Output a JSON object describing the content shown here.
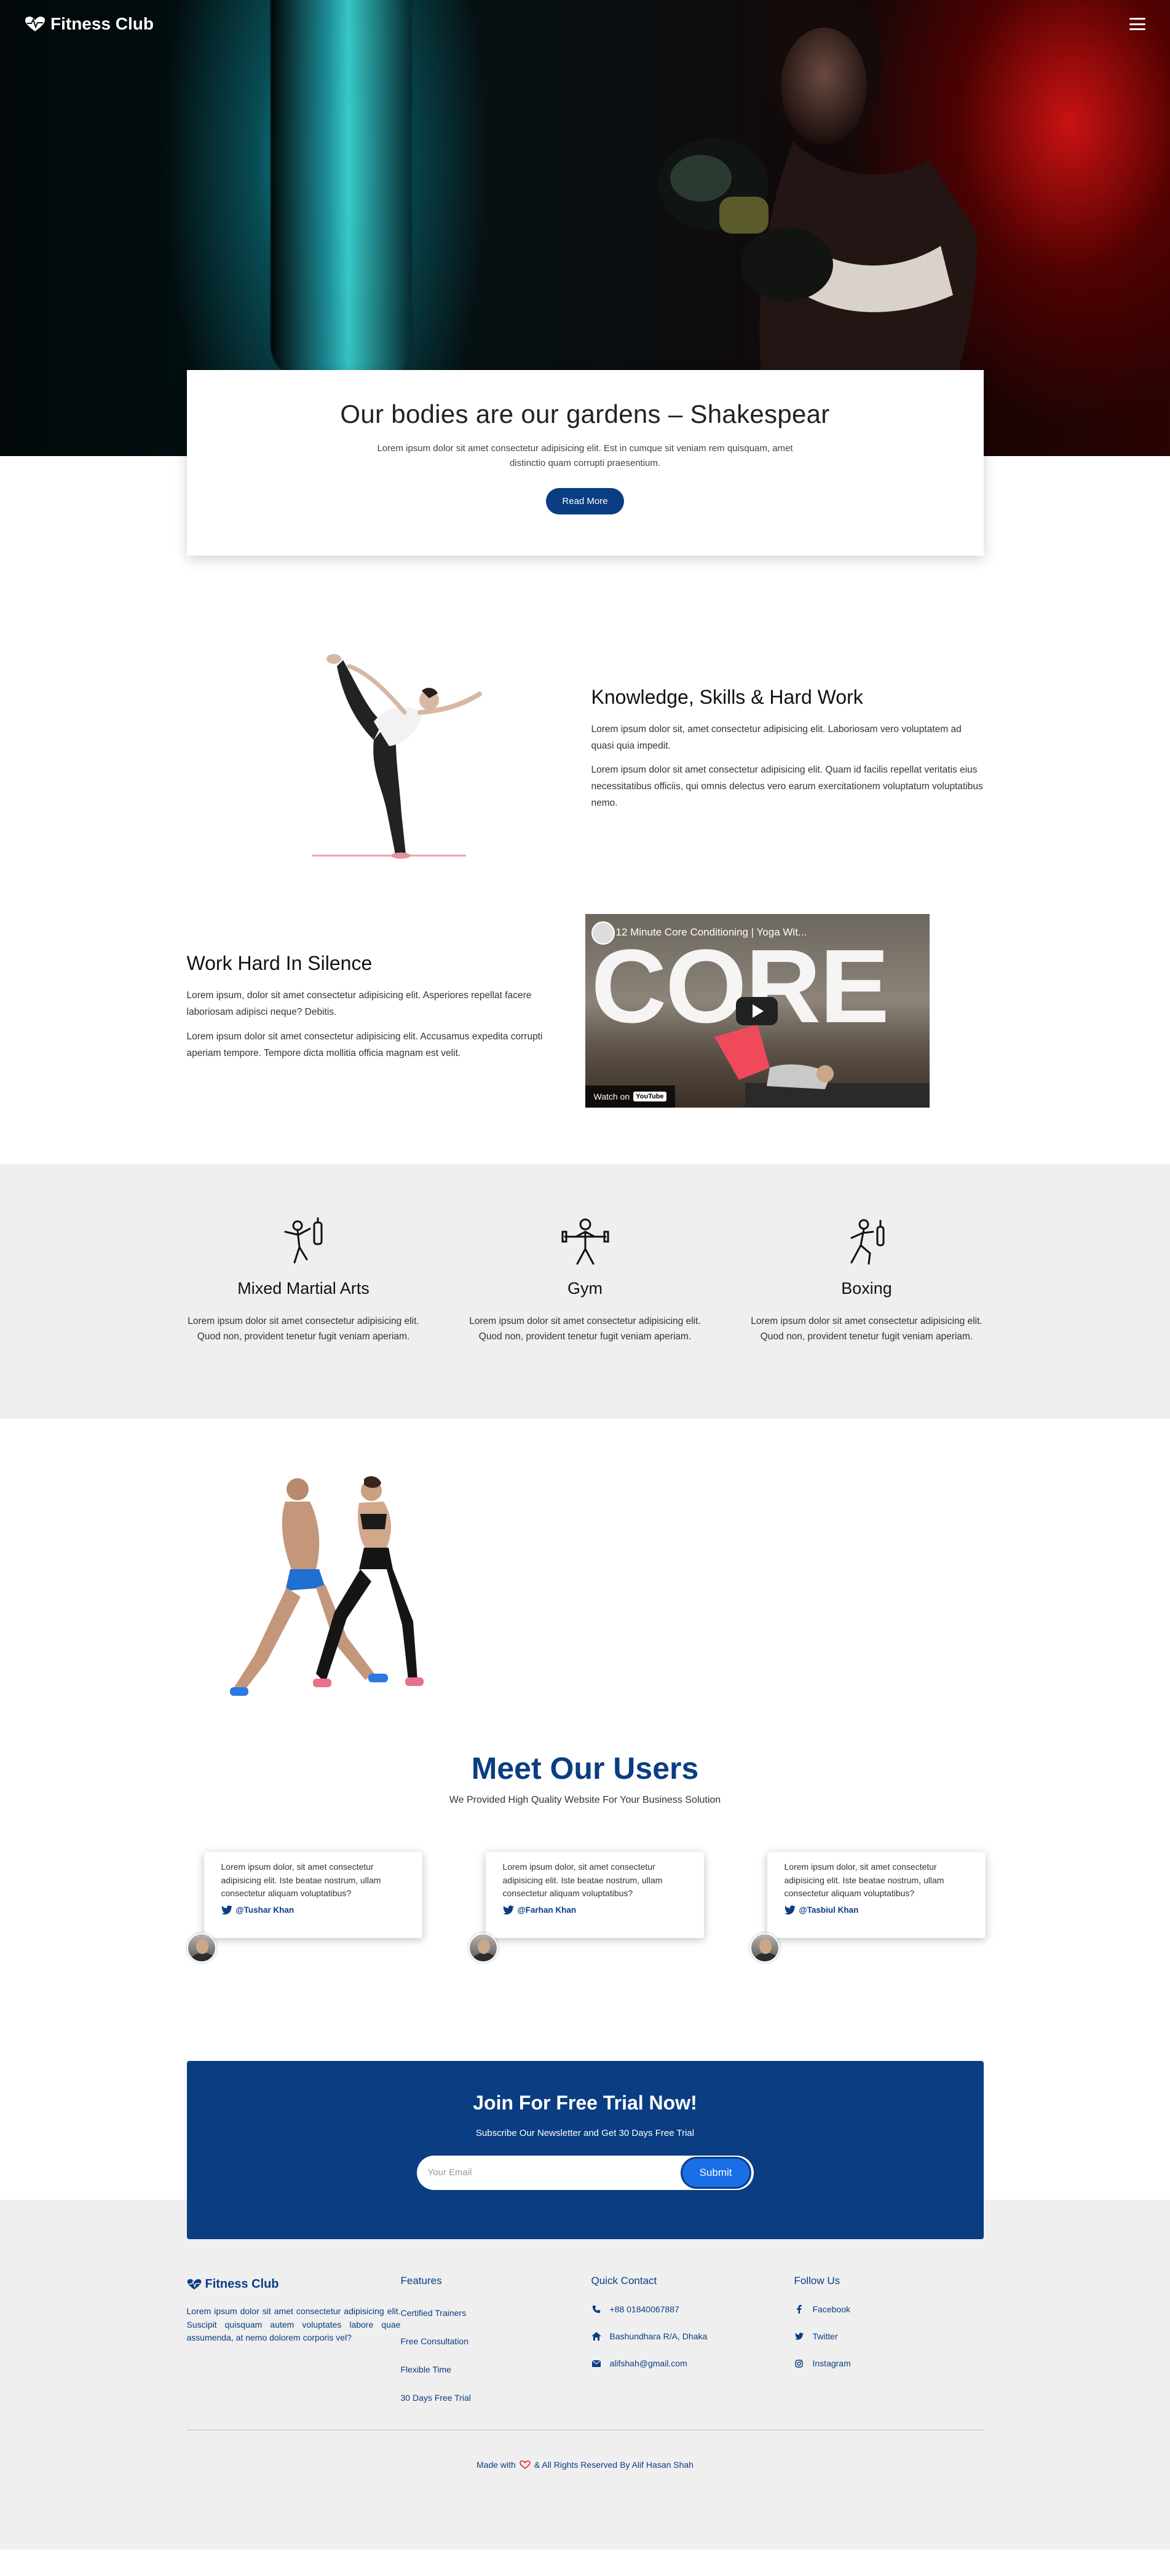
{
  "nav": {
    "brand": "Fitness Club"
  },
  "hero": {
    "title": "Our bodies are our gardens – Shakespear",
    "text": "Lorem ipsum dolor sit amet consectetur adipisicing elit. Est in cumque sit veniam rem quisquam, amet distinctio quam corrupti praesentium.",
    "button": "Read More"
  },
  "knowledge": {
    "title": "Knowledge, Skills & Hard Work",
    "p1": "Lorem ipsum dolor sit, amet consectetur adipisicing elit. Laboriosam vero voluptatem ad quasi quia impedit.",
    "p2": "Lorem ipsum dolor sit amet consectetur adipisicing elit. Quam id facilis repellat veritatis eius necessitatibus officiis, qui omnis delectus vero earum exercitationem voluptatum voluptatibus nemo."
  },
  "work": {
    "title": "Work Hard In Silence",
    "p1": "Lorem ipsum, dolor sit amet consectetur adipisicing elit. Asperiores repellat facere laboriosam adipisci neque? Debitis.",
    "p2": "Lorem ipsum dolor sit amet consectetur adipisicing elit. Accusamus expedita corrupti aperiam tempore. Tempore dicta mollitia officia magnam est velit."
  },
  "video": {
    "title": "12 Minute Core Conditioning | Yoga Wit...",
    "overlay_word": "CORE",
    "watch_on": "Watch on",
    "youtube": "YouTube"
  },
  "services": [
    {
      "icon": "martial-arts-icon",
      "title": "Mixed Martial Arts",
      "text": "Lorem ipsum dolor sit amet consectetur adipisicing elit. Quod non, provident tenetur fugit veniam aperiam."
    },
    {
      "icon": "gym-icon",
      "title": "Gym",
      "text": "Lorem ipsum dolor sit amet consectetur adipisicing elit. Quod non, provident tenetur fugit veniam aperiam."
    },
    {
      "icon": "boxing-icon",
      "title": "Boxing",
      "text": "Lorem ipsum dolor sit amet consectetur adipisicing elit. Quod non, provident tenetur fugit veniam aperiam."
    }
  ],
  "users": {
    "title": "Meet Our Users",
    "subtitle": "We Provided High Quality Website For Your Business Solution",
    "testimonials": [
      {
        "text": "Lorem ipsum dolor, sit amet consectetur adipisicing elit. Iste beatae nostrum, ullam consectetur aliquam voluptatibus?",
        "handle": "@Tushar Khan"
      },
      {
        "text": "Lorem ipsum dolor, sit amet consectetur adipisicing elit. Iste beatae nostrum, ullam consectetur aliquam voluptatibus?",
        "handle": "@Farhan Khan"
      },
      {
        "text": "Lorem ipsum dolor, sit amet consectetur adipisicing elit. Iste beatae nostrum, ullam consectetur aliquam voluptatibus?",
        "handle": "@Tasbiul Khan"
      }
    ]
  },
  "trial": {
    "title": "Join For Free Trial Now!",
    "subtitle": "Subscribe Our Newsletter and Get 30 Days Free Trial",
    "placeholder": "Your Email",
    "button": "Submit"
  },
  "footer": {
    "brand": "Fitness Club",
    "about": "Lorem ipsum dolor sit amet consectetur adipisicing elit. Suscipit quisquam autem voluptates labore quae assumenda, at nemo dolorem corporis vel?",
    "features_head": "Features",
    "features": [
      "Certified Trainers",
      "Free Consultation",
      "Flexible Time",
      "30 Days Free Trial"
    ],
    "contact_head": "Quick Contact",
    "contact": [
      {
        "icon": "phone-icon",
        "text": "+88 01840067887"
      },
      {
        "icon": "home-icon",
        "text": "Bashundhara R/A, Dhaka"
      },
      {
        "icon": "envelope-icon",
        "text": "alifshah@gmail.com"
      }
    ],
    "follow_head": "Follow Us",
    "social": [
      {
        "icon": "facebook-icon",
        "text": "Facebook"
      },
      {
        "icon": "twitter-icon",
        "text": "Twitter"
      },
      {
        "icon": "instagram-icon",
        "text": "Instagram"
      }
    ],
    "copy_made": "Made with",
    "copy_rest": "& All Rights Reserved By Alif Hasan Shah"
  },
  "colors": {
    "primary": "#0a3d82",
    "accent": "#1a6fe6",
    "light_bg": "#efefef"
  }
}
